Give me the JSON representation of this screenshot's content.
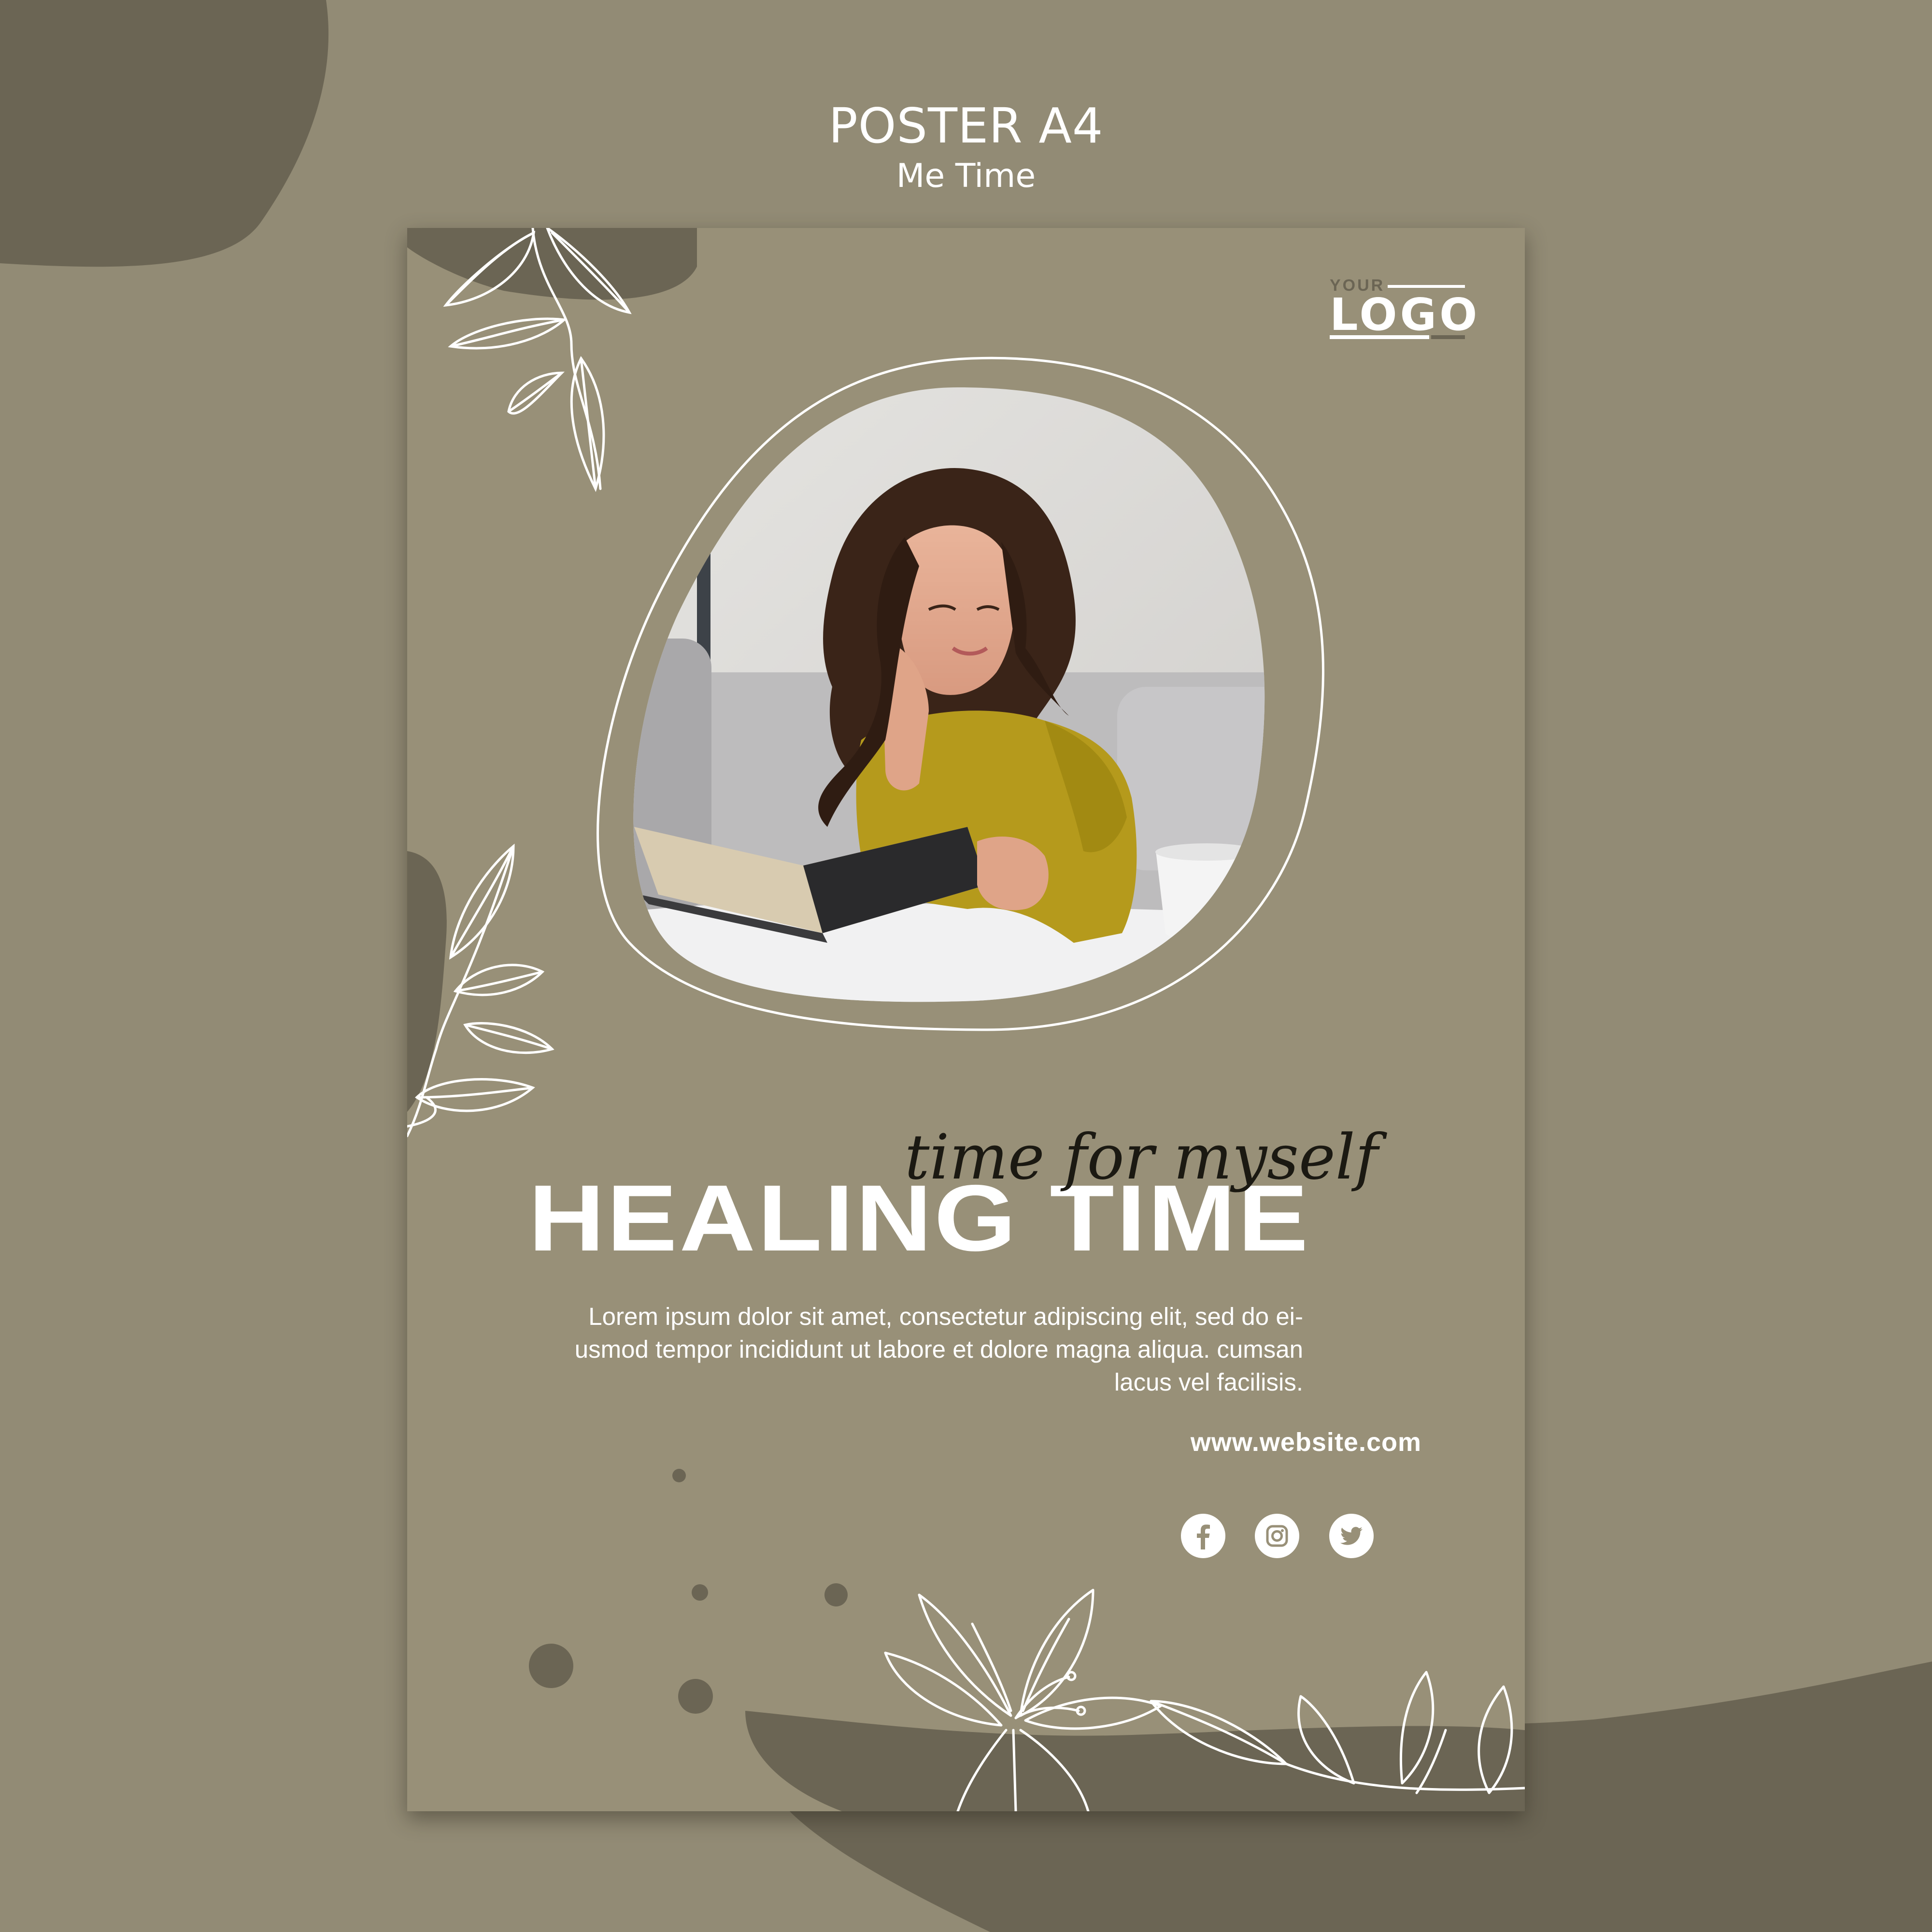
{
  "header": {
    "title": "POSTER A4",
    "subtitle": "Me Time"
  },
  "poster": {
    "logo": {
      "small": "YOUR",
      "word": "LOGO"
    },
    "script_line": "time for myself",
    "headline": "HEALING TIME",
    "body": "Lorem ipsum dolor sit amet, consectetur adipiscing elit, sed do ei-usmod tempor incididunt ut labore et dolore magna aliqua. cumsan lacus vel facilisis.",
    "website": "www.website.com",
    "social": [
      {
        "network": "facebook",
        "icon": "facebook-icon"
      },
      {
        "network": "instagram",
        "icon": "instagram-icon"
      },
      {
        "network": "twitter",
        "icon": "twitter-icon"
      }
    ]
  },
  "colors": {
    "background": "#928b75",
    "poster": "#989078",
    "dark_blob": "#6b6554",
    "text": "#ffffff",
    "shirt": "#b59a1c"
  }
}
